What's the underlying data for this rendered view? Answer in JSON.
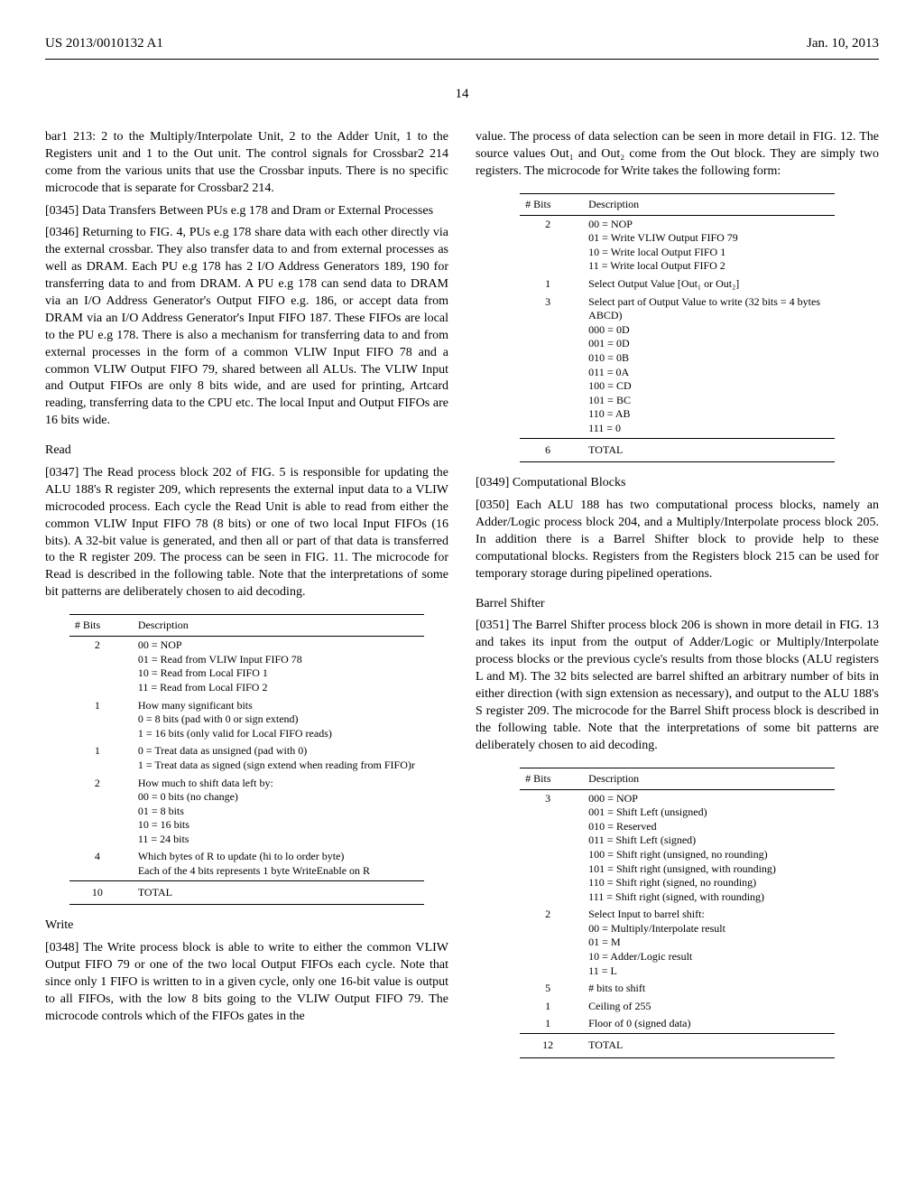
{
  "header": {
    "pub_no": "US 2013/0010132 A1",
    "pub_date": "Jan. 10, 2013",
    "page_no": "14"
  },
  "left": {
    "p1": "bar1 213: 2 to the Multiply/Interpolate Unit, 2 to the Adder Unit, 1 to the Registers unit and 1 to the Out unit. The control signals for Crossbar2 214 come from the various units that use the Crossbar inputs. There is no specific microcode that is separate for Crossbar2 214.",
    "p2_num": "[0345]",
    "p2": "    Data Transfers Between PUs e.g 178 and Dram or External Processes",
    "p3_num": "[0346]",
    "p3": "    Returning to FIG. 4, PUs e.g 178 share data with each other directly via the external crossbar. They also transfer data to and from external processes as well as DRAM. Each PU e.g 178 has 2 I/O Address Generators 189, 190 for transferring data to and from DRAM. A PU e.g 178 can send data to DRAM via an I/O Address Generator's Output FIFO e.g. 186, or accept data from DRAM via an I/O Address Generator's Input FIFO 187. These FIFOs are local to the PU e.g 178. There is also a mechanism for transferring data to and from external processes in the form of a common VLIW Input FIFO 78 and a common VLIW Output FIFO 79, shared between all ALUs. The VLIW Input and Output FIFOs are only 8 bits wide, and are used for printing, Artcard reading, transferring data to the CPU etc. The local Input and Output FIFOs are 16 bits wide.",
    "read_title": "Read",
    "p4_num": "[0347]",
    "p4": "    The Read process block 202 of FIG. 5 is responsible for updating the ALU 188's R register 209, which represents the external input data to a VLIW microcoded process. Each cycle the Read Unit is able to read from either the common VLIW Input FIFO 78 (8 bits) or one of two local Input FIFOs (16 bits). A 32-bit value is generated, and then all or part of that data is transferred to the R register 209. The process can be seen in FIG. 11. The microcode for Read is described in the following table. Note that the interpretations of some bit patterns are deliberately chosen to aid decoding.",
    "table1": {
      "h1": "# Bits",
      "h2": "Description",
      "rows": [
        {
          "bits": "2",
          "desc": "00 = NOP\n01 = Read from VLIW Input FIFO 78\n10 = Read from Local FIFO 1\n11 = Read from Local FIFO 2"
        },
        {
          "bits": "1",
          "desc": "How many significant bits\n0 = 8 bits (pad with 0 or sign extend)\n1 = 16 bits (only valid for Local FIFO reads)"
        },
        {
          "bits": "1",
          "desc": "0 = Treat data as unsigned (pad with 0)\n1 = Treat data as signed (sign extend when reading from FIFO)r"
        },
        {
          "bits": "2",
          "desc": "How much to shift data left by:\n00 = 0 bits (no change)\n01 = 8 bits\n10 = 16 bits\n11 = 24 bits"
        },
        {
          "bits": "4",
          "desc": "Which bytes of R to update (hi to lo order byte)\nEach of the 4 bits represents 1 byte WriteEnable on R"
        }
      ],
      "total_bits": "10",
      "total_label": "TOTAL"
    },
    "write_title": "Write",
    "p5_num": "[0348]",
    "p5": "    The Write process block is able to write to either the common VLIW Output FIFO 79 or one of the two local Output FIFOs each cycle. Note that since only 1 FIFO is written to in a given cycle, only one 16-bit value is output to all FIFOs, with the low 8 bits going to the VLIW Output FIFO 79. The microcode controls which of the FIFOs gates in the"
  },
  "right": {
    "p1": "value. The process of data selection can be seen in more detail in FIG. 12. The source values Out₁ and Out₂ come from the Out block. They are simply two registers. The microcode for Write takes the following form:",
    "table2": {
      "h1": "# Bits",
      "h2": "Description",
      "rows": [
        {
          "bits": "2",
          "desc": "00 = NOP\n01 = Write VLIW Output FIFO 79\n10 = Write local Output FIFO 1\n11 = Write local Output FIFO 2"
        },
        {
          "bits": "1",
          "desc": "Select Output Value [Out₁ or Out₂]"
        },
        {
          "bits": "3",
          "desc": "Select part of Output Value to write (32 bits = 4 bytes ABCD)\n000 = 0D\n001 = 0D\n010 = 0B\n011 = 0A\n100 = CD\n101 = BC\n110 = AB\n111 = 0"
        }
      ],
      "total_bits": "6",
      "total_label": "TOTAL"
    },
    "p2_num": "[0349]",
    "p2": "    Computational Blocks",
    "p3_num": "[0350]",
    "p3": "    Each ALU 188 has two computational process blocks, namely an Adder/Logic process block 204, and a Multiply/Interpolate process block 205. In addition there is a Barrel Shifter block to provide help to these computational blocks. Registers from the Registers block 215 can be used for temporary storage during pipelined operations.",
    "barrel_title": "Barrel Shifter",
    "p4_num": "[0351]",
    "p4": "    The Barrel Shifter process block 206 is shown in more detail in FIG. 13 and takes its input from the output of Adder/Logic or Multiply/Interpolate process blocks or the previous cycle's results from those blocks (ALU registers L and M). The 32 bits selected are barrel shifted an arbitrary number of bits in either direction (with sign extension as necessary), and output to the ALU 188's S register 209. The microcode for the Barrel Shift process block is described in the following table. Note that the interpretations of some bit patterns are deliberately chosen to aid decoding.",
    "table3": {
      "h1": "# Bits",
      "h2": "Description",
      "rows": [
        {
          "bits": "3",
          "desc": "000 = NOP\n001 = Shift Left (unsigned)\n010 = Reserved\n011 = Shift Left (signed)\n100 = Shift right (unsigned, no rounding)\n101 = Shift right (unsigned, with rounding)\n110 = Shift right (signed, no rounding)\n111 = Shift right (signed, with rounding)"
        },
        {
          "bits": "2",
          "desc": "Select Input to barrel shift:\n00 = Multiply/Interpolate result\n01 = M\n10 = Adder/Logic result\n11 = L"
        },
        {
          "bits": "5",
          "desc": "# bits to shift"
        },
        {
          "bits": "1",
          "desc": "Ceiling of 255"
        },
        {
          "bits": "1",
          "desc": "Floor of 0 (signed data)"
        }
      ],
      "total_bits": "12",
      "total_label": "TOTAL"
    }
  }
}
